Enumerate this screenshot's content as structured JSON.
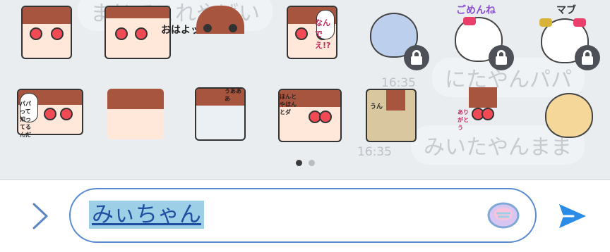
{
  "background_messages": {
    "top_fragment": "まじでこれやばい",
    "bubble_1": "にたやんパパ",
    "time_1": "16:35",
    "bubble_2": "みいたやんまま",
    "time_2": "16:35"
  },
  "sticker_panel": {
    "row_1": [
      {
        "name": "sticker-girl-crying"
      },
      {
        "name": "sticker-ohayo",
        "caption": "おはよッ"
      },
      {
        "name": "sticker-girl-sparkle"
      },
      {
        "name": "sticker-nande",
        "caption": "なんで え!?"
      },
      {
        "name": "sticker-blue-cat",
        "locked": true
      },
      {
        "name": "sticker-gomenne",
        "caption": "ごめんね",
        "locked": true
      },
      {
        "name": "sticker-mabu",
        "caption": "マブ",
        "locked": true
      }
    ],
    "row_2": [
      {
        "name": "sticker-girl-papa",
        "caption": "パパって 知ってるんだ"
      },
      {
        "name": "sticker-girl-dots"
      },
      {
        "name": "sticker-girl-crying-2",
        "caption": "うあああ"
      },
      {
        "name": "sticker-girl-honto",
        "caption": "ほんとやほんとダ"
      },
      {
        "name": "sticker-girl-scarf",
        "caption": "うん"
      },
      {
        "name": "sticker-arigato",
        "caption": "ありがとう"
      },
      {
        "name": "sticker-orange-cat"
      }
    ],
    "page_indicator": {
      "current": 1,
      "total": 2
    }
  },
  "input_bar": {
    "text_value": "みぃちゃん",
    "colors": {
      "accent": "#2a8ce6",
      "border": "#5a8bd0",
      "highlight": "#9dd0e6"
    }
  },
  "icons": {
    "expand": "chevron-right-icon",
    "sticker": "sticker-icon",
    "send": "send-icon",
    "lock": "lock-icon"
  }
}
